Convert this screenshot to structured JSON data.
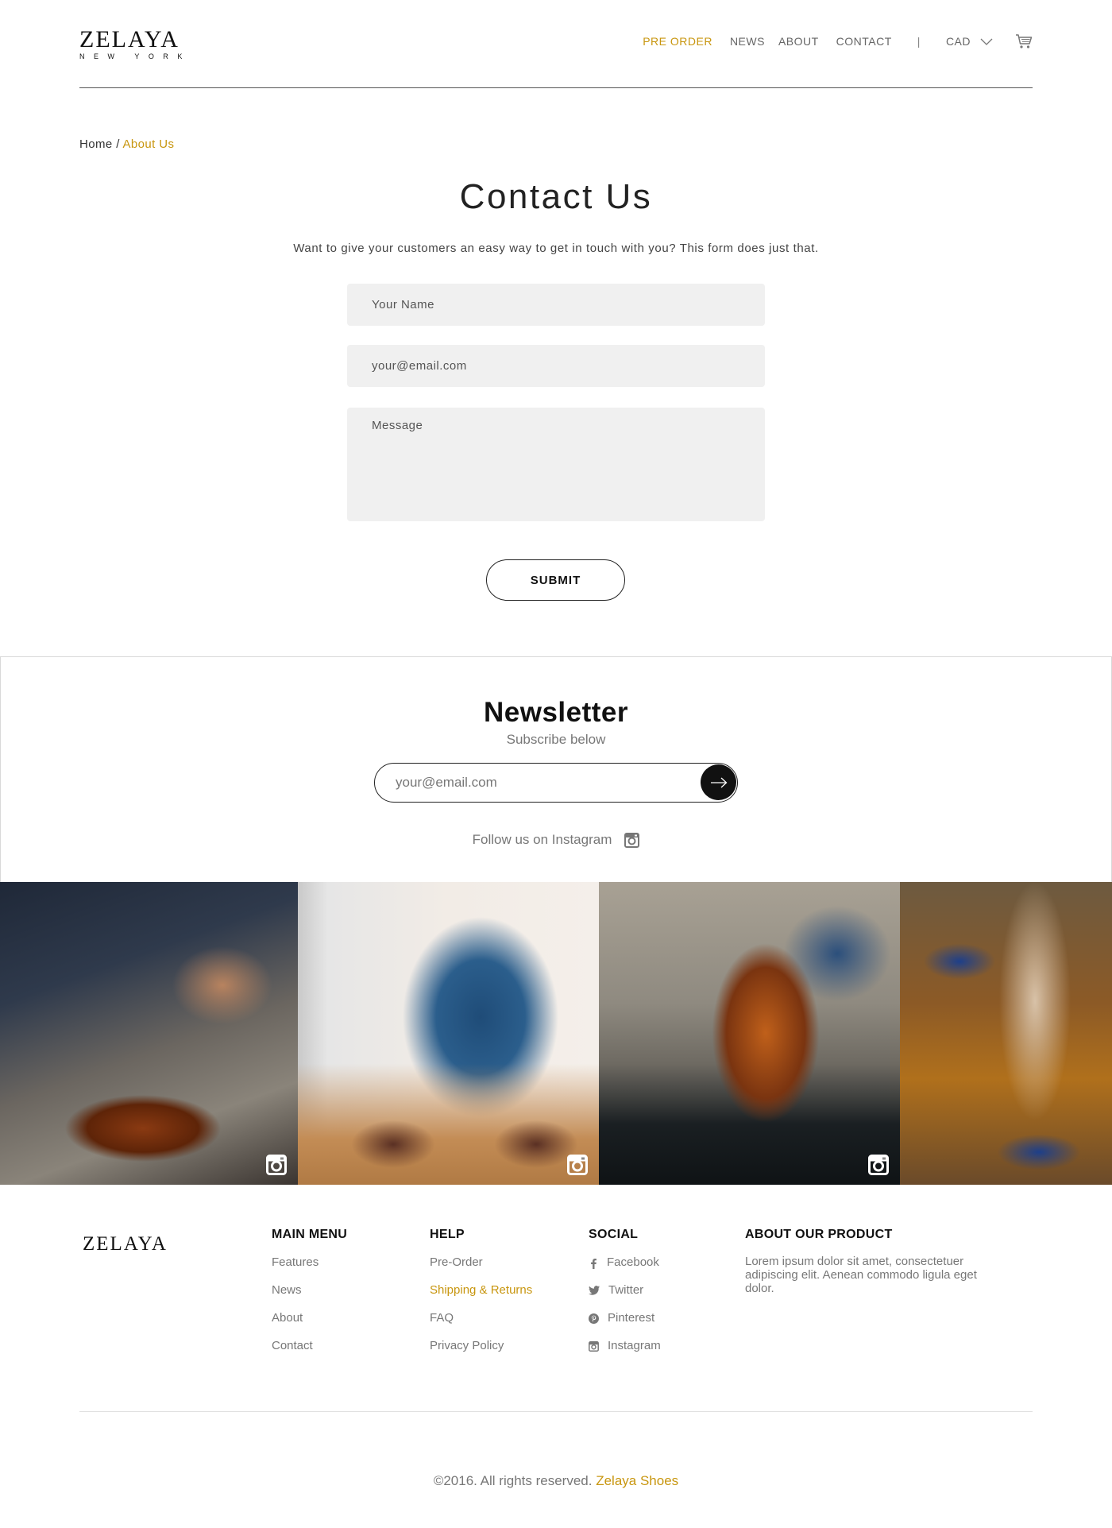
{
  "header": {
    "logo_main": "ZELAYA",
    "logo_sub": "NEW YORK",
    "nav": {
      "preorder": "PRE ORDER",
      "news": "NEWS",
      "about": "ABOUT",
      "contact": "CONTACT",
      "separator": "|",
      "currency": "CAD"
    },
    "icons": {
      "currency": "chevron-down-icon",
      "cart": "cart-icon"
    }
  },
  "breadcrumb": {
    "home": "Home",
    "separator": " / ",
    "current": "About Us"
  },
  "contact": {
    "title": "Contact Us",
    "subtitle": "Want to give your customers an easy way to get in touch with you? This form does just that.",
    "name_placeholder": "Your Name",
    "email_placeholder": "your@email.com",
    "message_placeholder": "Message",
    "submit_label": "SUBMIT"
  },
  "newsletter": {
    "title": "Newsletter",
    "subtitle": "Subscribe below",
    "email_placeholder": "your@email.com",
    "follow_text": "Follow us on Instagram",
    "icons": {
      "submit": "arrow-right-icon",
      "follow": "instagram-icon"
    }
  },
  "gallery": {
    "photos": [
      "photo-1",
      "photo-2",
      "photo-3",
      "photo-4"
    ],
    "overlay_icon": "instagram-icon"
  },
  "footer": {
    "logo": "ZELAYA",
    "main_menu": {
      "title": "MAIN MENU",
      "items": [
        "Features",
        "News",
        "About",
        "Contact"
      ]
    },
    "help": {
      "title": "HELP",
      "items": [
        "Pre-Order",
        "Shipping & Returns",
        "FAQ",
        "Privacy Policy"
      ]
    },
    "social": {
      "title": "SOCIAL",
      "items": [
        "Facebook",
        "Twitter",
        "Pinterest",
        "Instagram"
      ],
      "icons": [
        "facebook-icon",
        "twitter-icon",
        "pinterest-icon",
        "instagram-icon"
      ]
    },
    "about": {
      "title": "ABOUT OUR PRODUCT",
      "text": "Lorem ipsum dolor sit amet, consectetuer adipiscing elit. Aenean commodo ligula eget dolor."
    },
    "copyright_text": "©2016. All rights reserved.",
    "copyright_brand": "Zelaya Shoes"
  },
  "colors": {
    "accent": "#c8960f",
    "text": "#222222",
    "muted": "#777777",
    "field_bg": "#f0f0f0"
  }
}
